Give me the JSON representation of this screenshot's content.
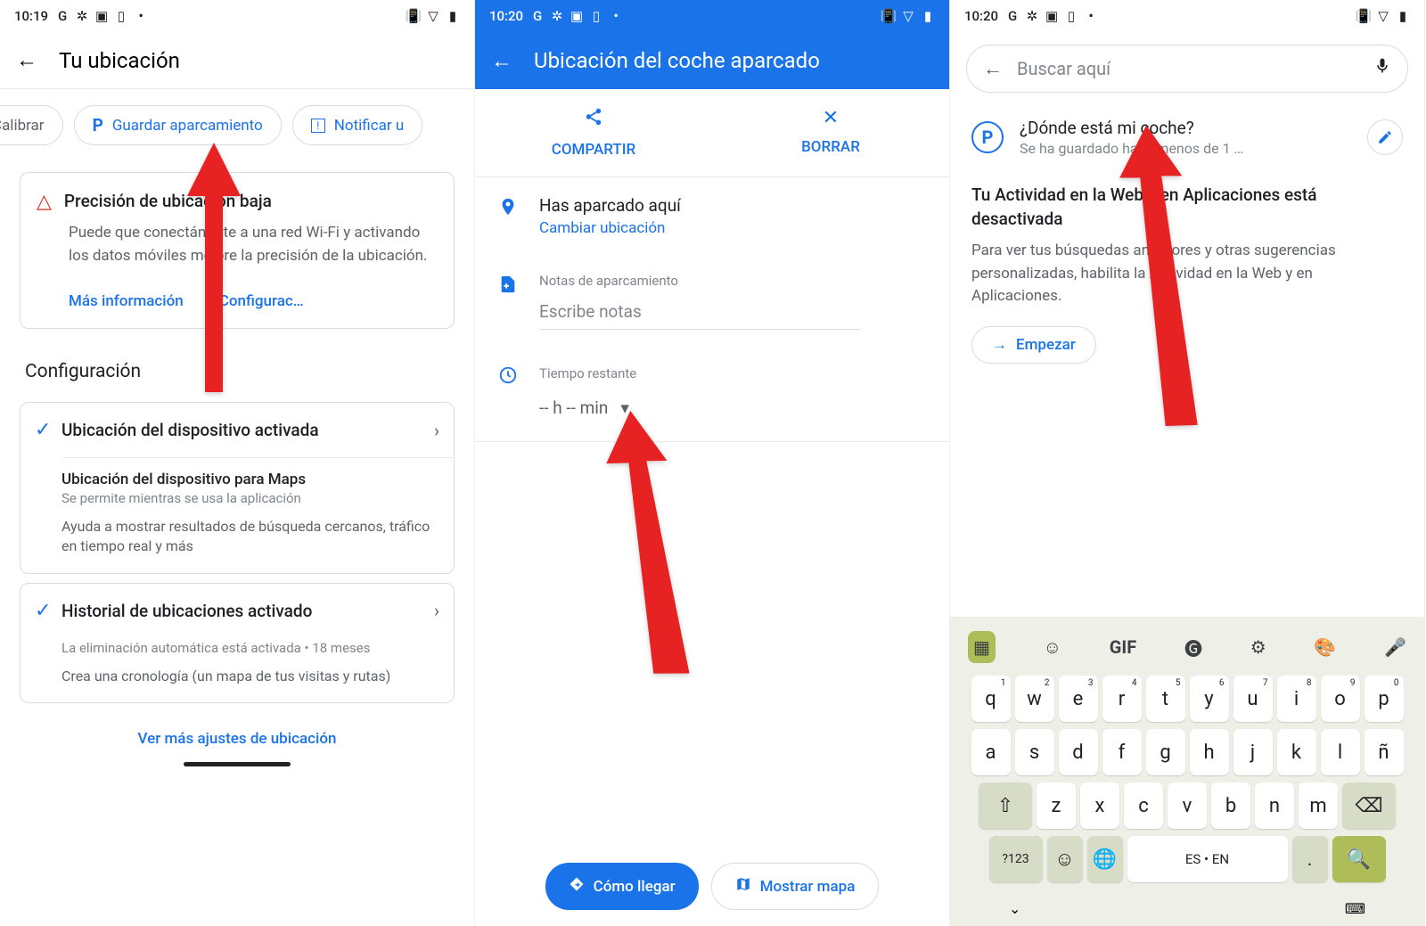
{
  "screen1": {
    "statusbar": {
      "time": "10:19"
    },
    "header": {
      "title": "Tu ubicación"
    },
    "chips": {
      "calibrate": "Calibrar",
      "save": "Guardar aparcamiento",
      "notify": "Notificar u"
    },
    "warning": {
      "title": "Precisión de ubicación baja",
      "body": "Puede que conectándote a una red Wi-Fi y activando los datos móviles mejore la precisión de la ubicación.",
      "more": "Más información",
      "config": "Configurac…"
    },
    "section_title": "Configuración",
    "device_loc": {
      "title": "Ubicación del dispositivo activada",
      "sub_title": "Ubicación del dispositivo para Maps",
      "sub_note": "Se permite mientras se usa la aplicación",
      "sub_desc": "Ayuda a mostrar resultados de búsqueda cercanos, tráfico en tiempo real y más"
    },
    "history": {
      "title": "Historial de ubicaciones activado",
      "sub_note": "La eliminación automática está activada • 18 meses",
      "sub_desc": "Crea una cronología (un mapa de tus visitas y rutas)"
    },
    "more_link": "Ver más ajustes de ubicación"
  },
  "screen2": {
    "statusbar": {
      "time": "10:20"
    },
    "header": {
      "title": "Ubicación del coche aparcado"
    },
    "share": "COMPARTIR",
    "delete": "BORRAR",
    "parked": {
      "title": "Has aparcado aquí",
      "change": "Cambiar ubicación"
    },
    "notes": {
      "label": "Notas de aparcamiento",
      "placeholder": "Escribe notas"
    },
    "time": {
      "label": "Tiempo restante",
      "value": "-- h -- min"
    },
    "directions": "Cómo llegar",
    "show_map": "Mostrar mapa"
  },
  "screen3": {
    "statusbar": {
      "time": "10:20"
    },
    "search_placeholder": "Buscar aquí",
    "result": {
      "title": "¿Dónde está mi coche?",
      "subtitle": "Se ha guardado hace menos de 1 …"
    },
    "activity": {
      "title": "Tu Actividad en la Web y en Aplicaciones está desactivada",
      "desc": "Para ver tus búsquedas anteriores y otras sugerencias personalizadas, habilita la Actividad en la Web y en Aplicaciones.",
      "start": "Empezar"
    },
    "keyboard": {
      "row1": [
        "q",
        "w",
        "e",
        "r",
        "t",
        "y",
        "u",
        "i",
        "o",
        "p"
      ],
      "row1_sup": [
        "1",
        "2",
        "3",
        "4",
        "5",
        "6",
        "7",
        "8",
        "9",
        "0"
      ],
      "row2": [
        "a",
        "s",
        "d",
        "f",
        "g",
        "h",
        "j",
        "k",
        "l",
        "ñ"
      ],
      "row3": [
        "z",
        "x",
        "c",
        "v",
        "b",
        "n",
        "m"
      ],
      "symbols": "?123",
      "lang": "ES • EN",
      "dot": "."
    }
  }
}
